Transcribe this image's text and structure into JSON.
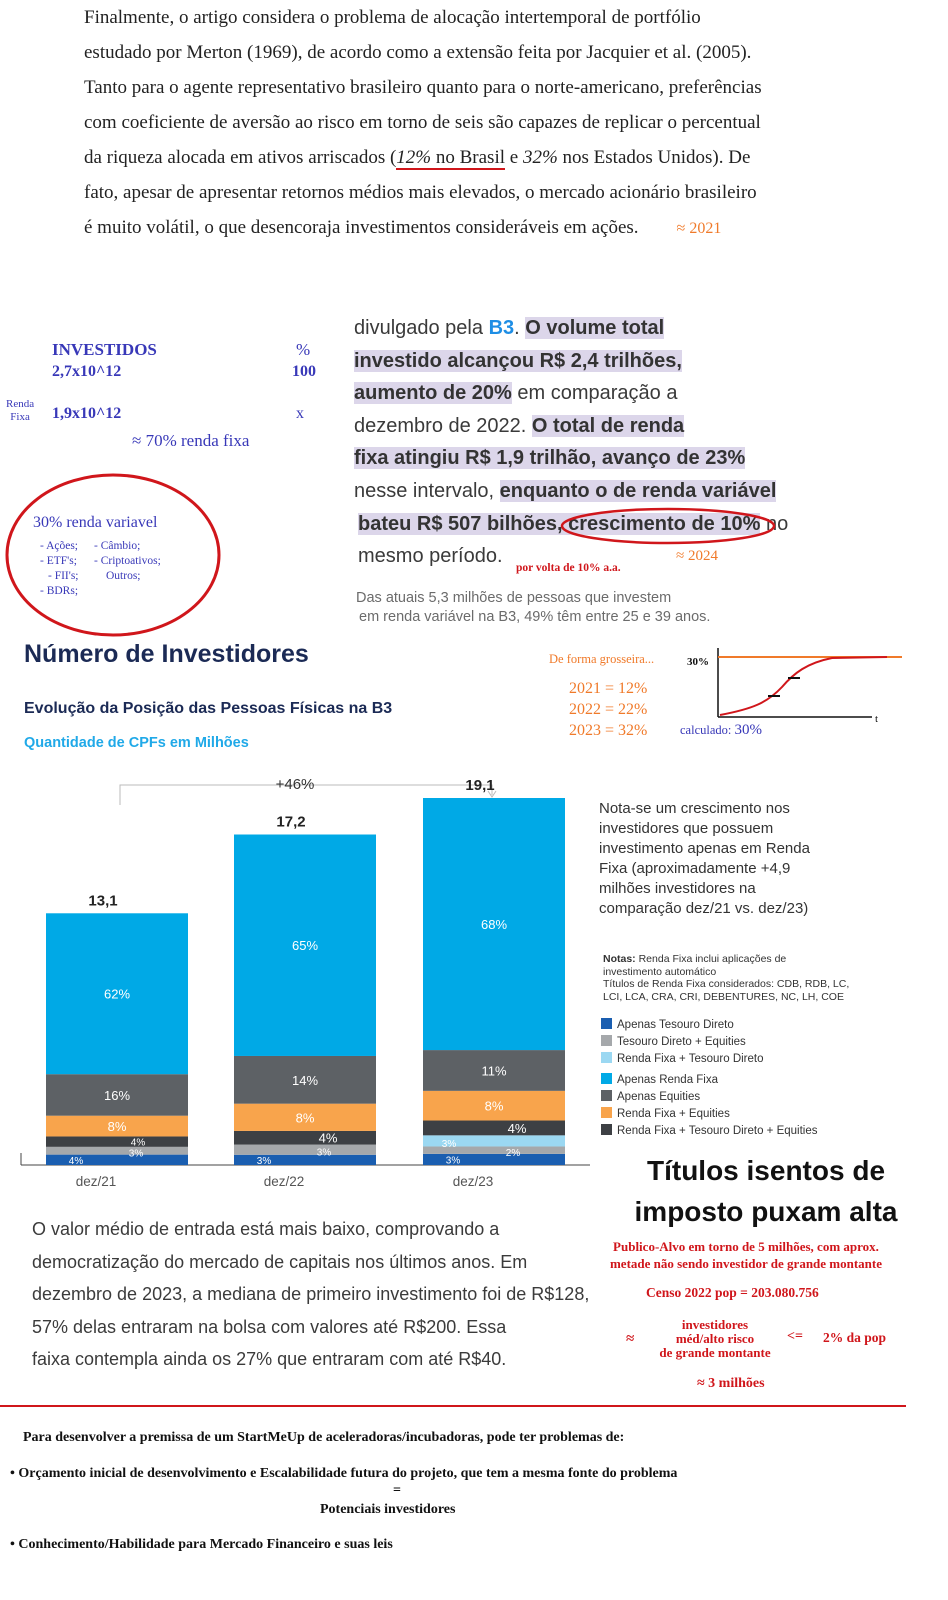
{
  "paper": {
    "line1": "Finalmente, o artigo considera o problema de alocação intertemporal de portfólio",
    "line2": "estudado por Merton (1969), de acordo como a extensão feita por Jacquier et al. (2005).",
    "line3": "Tanto para o agente representativo brasileiro quanto para o norte-americano, preferências",
    "line4": "com coeficiente de aversão ao risco em torno de seis são capazes de replicar o percentual",
    "line5_a": "da riqueza alocada em ativos arriscados (",
    "line5_pct_br": "12%",
    "line5_br": " no Brasil",
    "line5_b": " e ",
    "line5_pct_us": "32%",
    "line5_c": " nos Estados Unidos). De",
    "line6": "fato, apesar de apresentar retornos médios mais elevados, o mercado acionário brasileiro",
    "line7": "é muito volátil, o que desencoraja investimentos consideráveis em ações.",
    "year_note": "≈ 2021"
  },
  "handnotes": {
    "investidos_label": "INVESTIDOS",
    "pct_label": "%",
    "total_value": "2,7x10^12",
    "total_pct": "100",
    "renda_fixa_label_1": "Renda",
    "renda_fixa_label_2": "Fixa",
    "rf_value": "1,9x10^12",
    "rf_pct": "x",
    "rf_approx": "≈ 70% renda fixa",
    "rv_title": "30% renda variavel",
    "rv_items_left": [
      "- Ações;",
      "- ETF's;",
      "- FII's;",
      "- BDRs;"
    ],
    "rv_items_right": [
      "- Câmbio;",
      "- Criptoativos;",
      "Outros;"
    ],
    "growth_note": "por volta de 10% a.a.",
    "year_2024": "≈ 2024",
    "grosseira_label": "De forma grosseira...",
    "y2021": "2021 = 12%",
    "y2022": "2022 = 22%",
    "y2023": "2023 = 32%",
    "calculado_label": "calculado:",
    "calculado_value": "30%",
    "mini_y_label": "30%",
    "mini_x_label": "t"
  },
  "news": {
    "l1_a": "divulgado pela ",
    "l1_b3": "B3",
    "l1_dot": ". ",
    "l1_hl": "O volume total",
    "l2_hl": "investido alcançou R$ 2,4 trilhões,",
    "l3_hl": "aumento de 20%",
    "l3_b": " em comparação a",
    "l4_a": "dezembro de 2022. ",
    "l4_hl": "O total de renda",
    "l5_hl": "fixa atingiu R$ 1,9 trilhão, avanço de 23%",
    "l6_a": "nesse intervalo, ",
    "l6_hl": "enquanto o de renda variável",
    "l7_hl": "bateu R$ 507 bilhões, crescimento de 10%",
    "l7_b": " no",
    "l8": "mesmo período.",
    "sub1": "Das atuais 5,3 milhões de pessoas que investem",
    "sub2": "em renda variável na B3, 49% têm entre 25 e 39 anos."
  },
  "section": {
    "title": "Número de Investidores",
    "subtitle": "Evolução da Posição das Pessoas Físicas na B3",
    "caption": "Quantidade de CPFs em Milhões"
  },
  "chart_data": {
    "type": "bar",
    "stacked": true,
    "categories": [
      "dez/21",
      "dez/22",
      "dez/23"
    ],
    "totals": [
      13.1,
      17.2,
      19.1
    ],
    "total_labels": [
      "13,1",
      "17,2",
      "19,1"
    ],
    "growth_label": "+46%",
    "series": [
      {
        "name": "Apenas Tesouro Direto",
        "color": "#1a5eb0",
        "values": [
          4,
          3,
          3
        ]
      },
      {
        "name": "Tesouro Direto + Equities",
        "color": "#a5a8ab",
        "values": [
          3,
          3,
          2
        ]
      },
      {
        "name": "Renda Fixa + Tesouro Direto",
        "color": "#9bd8f2",
        "values": [
          0,
          0,
          3
        ]
      },
      {
        "name": "Apenas Renda Fixa",
        "color": "#00a9e6",
        "values": [
          62,
          65,
          68
        ]
      },
      {
        "name": "Apenas Equities",
        "color": "#5d6165",
        "values": [
          16,
          14,
          11
        ]
      },
      {
        "name": "Renda Fixa + Equities",
        "color": "#f8a44c",
        "values": [
          8,
          8,
          8
        ]
      },
      {
        "name": "Renda Fixa + Tesouro Direto + Equities",
        "color": "#3d4044",
        "values": [
          4,
          4,
          4
        ]
      }
    ],
    "unit": "%"
  },
  "chart_side": {
    "note_l1": "Nota-se um crescimento nos",
    "note_l2": "investidores que possuem",
    "note_l3": "investimento apenas em Renda",
    "note_l4": "Fixa (aproximadamente +4,9",
    "note_l5": "milhões investidores na",
    "note_l6": "comparação dez/21 vs. dez/23)",
    "notas_bold": "Notas:",
    "notas_1": " Renda Fixa inclui aplicações de",
    "notas_2": "investimento automático",
    "notas_3": "Títulos de Renda Fixa considerados:  CDB, RDB, LC,",
    "notas_4": "LCI, LCA, CRA, CRI, DEBENTURES, NC, LH, COE",
    "legend": [
      {
        "name": "Apenas Tesouro Direto",
        "color": "#1a5eb0"
      },
      {
        "name": "Tesouro Direto + Equities",
        "color": "#a5a8ab"
      },
      {
        "name": "Renda Fixa + Tesouro Direto",
        "color": "#9bd8f2"
      },
      {
        "name": "Apenas Renda Fixa",
        "color": "#00a9e6"
      },
      {
        "name": "Apenas Equities",
        "color": "#5d6165"
      },
      {
        "name": "Renda Fixa + Equities",
        "color": "#f8a44c"
      },
      {
        "name": "Renda Fixa + Tesouro Direto + Equities",
        "color": "#3d4044"
      }
    ]
  },
  "headline": {
    "l1": "Títulos isentos de",
    "l2": "imposto puxam alta"
  },
  "article2": {
    "l1": "O valor médio de entrada está mais baixo, comprovando a",
    "l2": "democratização do mercado de capitais nos últimos anos. Em",
    "l3": "dezembro de 2023, a mediana de primeiro investimento foi de R$128,",
    "l4": "57% delas entraram na bolsa com valores até R$200. Essa",
    "l5": "faixa contempla ainda os 27% que entraram com até R$40."
  },
  "redpanel": {
    "l1": "Publico-Alvo em torno de 5 milhões, com aprox.",
    "l2": "metade não sendo investidor de grande montante",
    "censo": "Censo 2022 pop = 203.080.756",
    "approx1": "≈",
    "inv_l1": "investidores",
    "inv_l2": "méd/alto risco",
    "inv_l3": "de grande montante",
    "lte": "<=",
    "pop_pct": "2% da pop",
    "approx_total": "≈  3 milhões"
  },
  "footer": {
    "intro": "Para desenvolver a premissa de um StartMeUp de aceleradoras/incubadoras, pode ter problemas de:",
    "bullet1": "Orçamento inicial de desenvolvimento e Escalabilidade futura do projeto, que tem a mesma fonte do problema",
    "equals": "=",
    "investidores": "Potenciais investidores",
    "bullet2": "Conhecimento/Habilidade para Mercado Financeiro e suas leis"
  },
  "colors": {
    "accent_red": "#d0161b",
    "accent_orange": "#f07a2a",
    "hand_blue": "#3838b8",
    "b3_blue": "#1e8ee5",
    "highlight": "#dcd6ea",
    "title_navy": "#1b2a55"
  }
}
